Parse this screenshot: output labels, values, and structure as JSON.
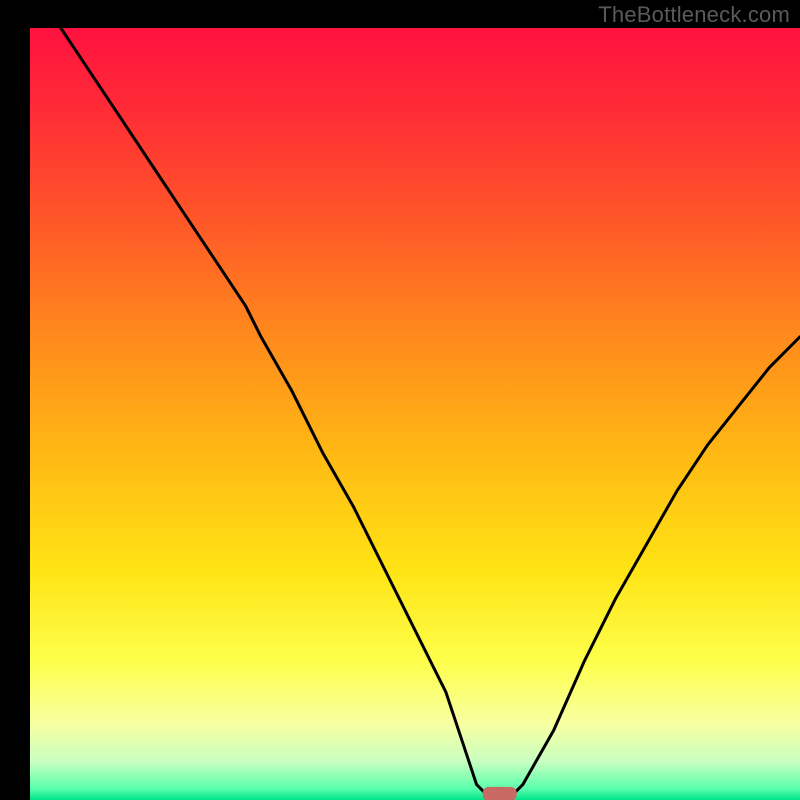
{
  "attribution": "TheBottleneck.com",
  "chart_data": {
    "type": "line",
    "title": "",
    "xlabel": "",
    "ylabel": "",
    "xlim": [
      0,
      100
    ],
    "ylim": [
      0,
      100
    ],
    "x": [
      4,
      8,
      12,
      16,
      20,
      24,
      28,
      30,
      34,
      38,
      42,
      46,
      50,
      54,
      56,
      58,
      60,
      62,
      64,
      68,
      72,
      76,
      80,
      84,
      88,
      92,
      96,
      100
    ],
    "values": [
      100,
      94,
      88,
      82,
      76,
      70,
      64,
      60,
      53,
      45,
      38,
      30,
      22,
      14,
      8,
      2,
      0,
      0,
      2,
      9,
      18,
      26,
      33,
      40,
      46,
      51,
      56,
      60
    ],
    "marker": {
      "x": 61,
      "y": 0.8
    },
    "gradient_stops": [
      {
        "offset": 0.0,
        "color": "#ff1240"
      },
      {
        "offset": 0.1,
        "color": "#ff2a36"
      },
      {
        "offset": 0.25,
        "color": "#ff5728"
      },
      {
        "offset": 0.4,
        "color": "#ff8a1c"
      },
      {
        "offset": 0.55,
        "color": "#ffb814"
      },
      {
        "offset": 0.7,
        "color": "#ffe314"
      },
      {
        "offset": 0.82,
        "color": "#fdff4a"
      },
      {
        "offset": 0.9,
        "color": "#f8ffa0"
      },
      {
        "offset": 0.95,
        "color": "#c9ffc0"
      },
      {
        "offset": 0.985,
        "color": "#5bffad"
      },
      {
        "offset": 1.0,
        "color": "#00e38a"
      }
    ]
  }
}
